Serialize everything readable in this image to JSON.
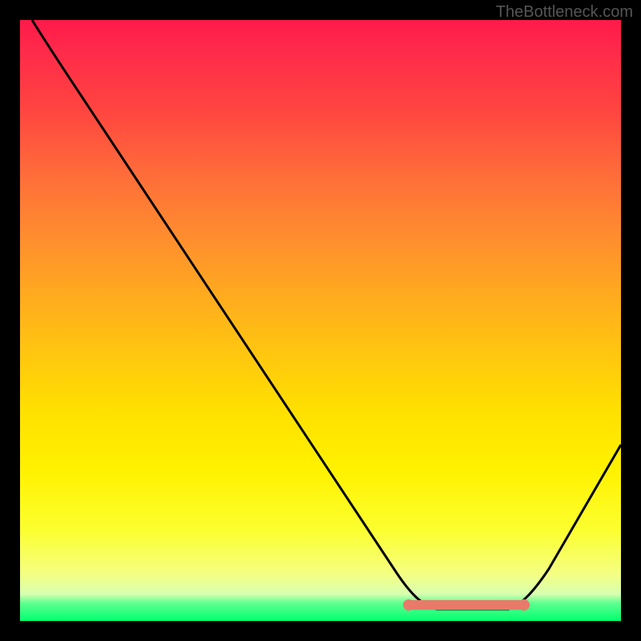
{
  "watermark": "TheBottleneck.com",
  "chart_data": {
    "type": "line",
    "title": "",
    "xlabel": "",
    "ylabel": "",
    "xlim": [
      0,
      100
    ],
    "ylim": [
      0,
      100
    ],
    "series": [
      {
        "name": "curve",
        "x": [
          2,
          10,
          20,
          30,
          40,
          50,
          60,
          65,
          70,
          75,
          80,
          85,
          90,
          100
        ],
        "y": [
          100,
          88,
          73,
          58,
          44,
          30,
          15,
          8,
          3,
          1,
          1,
          4,
          12,
          30
        ]
      }
    ],
    "marker": {
      "x_start": 65,
      "x_end": 84,
      "y": 3
    },
    "gradient_colors": {
      "top": "#ff1a4a",
      "mid": "#ffe000",
      "bottom": "#00ff70"
    }
  }
}
